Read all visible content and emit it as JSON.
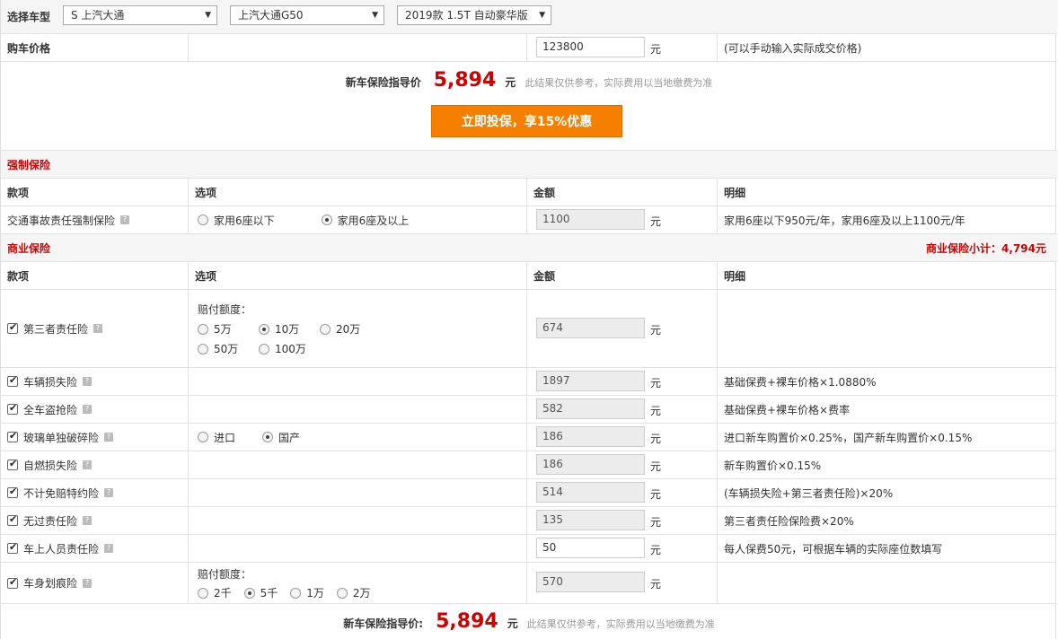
{
  "car": {
    "label": "选择车型",
    "brand": "S 上汽大通",
    "model": "上汽大通G50",
    "trim": "2019款 1.5T 自动豪华版"
  },
  "purchase": {
    "label": "购车价格",
    "price": "123800",
    "unit": "元",
    "hint": "(可以手动输入实际成交价格)"
  },
  "summary": {
    "label": "新车保险指导价",
    "label_colon": "新车保险指导价:",
    "amount": "5,894",
    "unit": "元",
    "note": "此结果仅供参考，实际费用以当地缴费为准",
    "cta": "立即投保，享15%优惠"
  },
  "headers": {
    "item": "款项",
    "option": "选项",
    "amount": "金额",
    "detail": "明细"
  },
  "compulsory": {
    "title": "强制保险",
    "name": "交通事故责任强制保险",
    "options": [
      "家用6座以下",
      "家用6座及以上"
    ],
    "selected": 1,
    "amount": "1100",
    "detail": "家用6座以下950元/年，家用6座及以上1100元/年"
  },
  "commercial": {
    "title": "商业保险",
    "subtotal": "商业保险小计：4,794元",
    "third_party": {
      "name": "第三者责任险",
      "option_label": "赔付额度：",
      "options": [
        "5万",
        "10万",
        "20万",
        "50万",
        "100万"
      ],
      "selected": 1,
      "amount": "674"
    },
    "rows": [
      {
        "name": "车辆损失险",
        "amount": "1897",
        "detail": "基础保费+裸车价格×1.0880%"
      },
      {
        "name": "全车盗抢险",
        "amount": "582",
        "detail": "基础保费+裸车价格×费率"
      },
      {
        "name": "玻璃单独破碎险",
        "amount": "186",
        "detail": "进口新车购置价×0.25%，国产新车购置价×0.15%",
        "options": [
          "进口",
          "国产"
        ],
        "selected": 1
      },
      {
        "name": "自燃损失险",
        "amount": "186",
        "detail": "新车购置价×0.15%"
      },
      {
        "name": "不计免赔特约险",
        "amount": "514",
        "detail": "(车辆损失险+第三者责任险)×20%"
      },
      {
        "name": "无过责任险",
        "amount": "135",
        "detail": "第三者责任险保险费×20%"
      },
      {
        "name": "车上人员责任险",
        "amount": "50",
        "detail": "每人保费50元，可根据车辆的实际座位数填写"
      }
    ],
    "scratch": {
      "name": "车身划痕险",
      "option_label": "赔付额度：",
      "options": [
        "2千",
        "5千",
        "1万",
        "2万"
      ],
      "selected": 1,
      "amount": "570"
    }
  }
}
